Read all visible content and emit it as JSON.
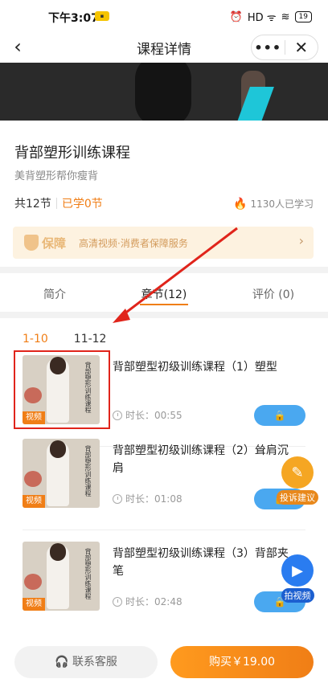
{
  "status_bar": {
    "time": "下午3:07",
    "signal": "HD ᯤ",
    "wifi": "≋",
    "battery": "19"
  },
  "navbar": {
    "title": "课程详情",
    "more": "•••",
    "close": "✕",
    "back": "‹"
  },
  "course": {
    "title": "背部塑形训练课程",
    "subtitle": "美背塑形帮你瘦背",
    "total": "共12节",
    "learned": "已学0节",
    "learners": "1130人已学习"
  },
  "guarantee": {
    "brand": "保障",
    "text": "高清视频·消费者保障服务",
    "arrow": "›"
  },
  "tabs": [
    {
      "label": "简介"
    },
    {
      "label": "章节(12)"
    },
    {
      "label": "评价 (0)"
    }
  ],
  "ranges": [
    "1-10",
    "11-12"
  ],
  "lessons": [
    {
      "title": "背部塑型初级训练课程（1）塑型",
      "duration": "时长：00:55",
      "tag": "视频"
    },
    {
      "title": "背部塑型初级训练课程（2）耸肩沉肩",
      "duration": "时长：01:08",
      "tag": "视频"
    },
    {
      "title": "背部塑型初级训练课程（3）背部夹笔",
      "duration": "时长：02:48",
      "tag": "视频"
    }
  ],
  "floating": {
    "complain": "投诉建议",
    "video": "拍视频"
  },
  "bottom": {
    "service": "联系客服",
    "buy": "购买￥19.00"
  },
  "colors": {
    "accent": "#f07e16",
    "lock": "#4aa8f0",
    "annotation": "#e0241b"
  }
}
